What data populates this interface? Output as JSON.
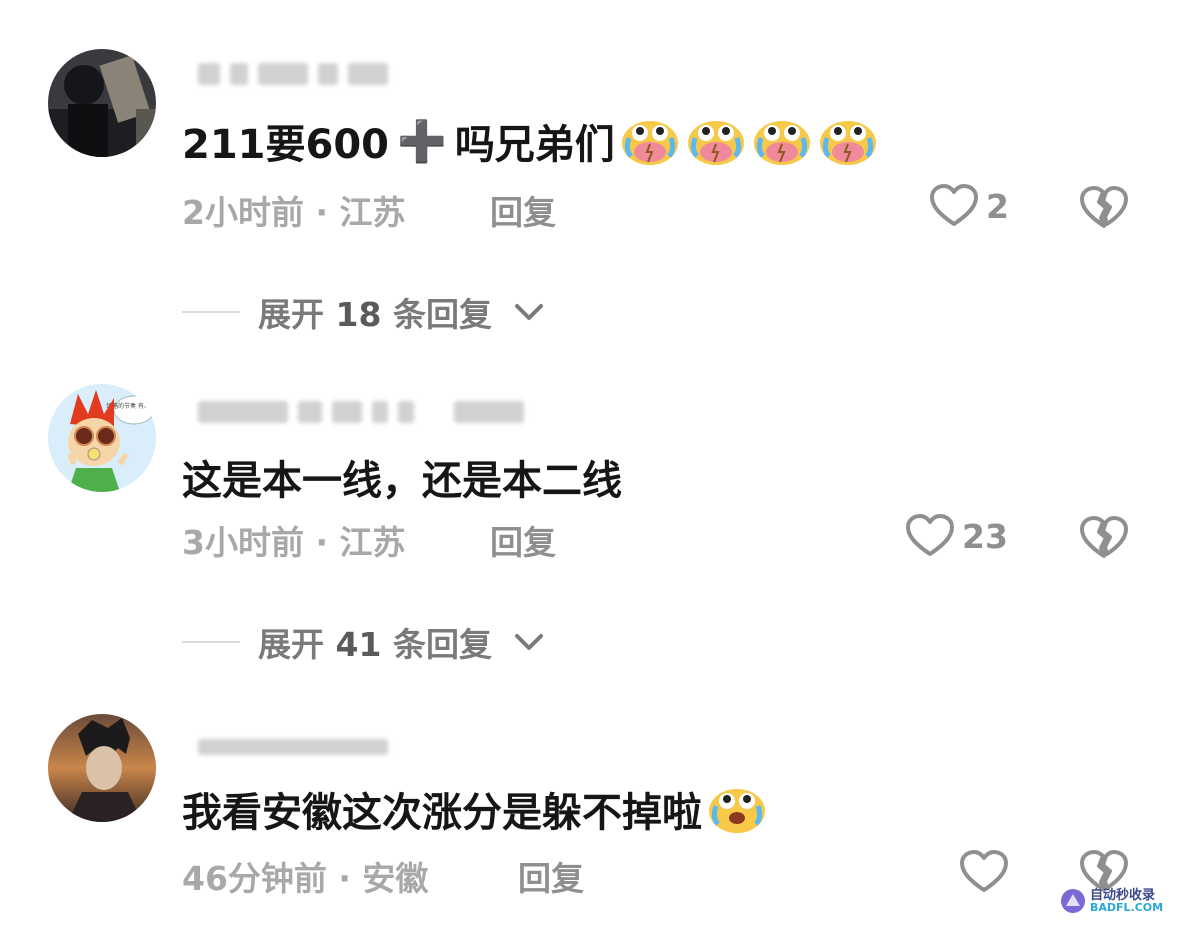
{
  "comments": [
    {
      "text": "211要600",
      "text_tail": "吗兄弟们",
      "plus_glyph": "➕",
      "emoji_count": 4,
      "time": "2小时前",
      "location": "江苏",
      "meta": "2小时前 · 江苏",
      "reply_label": "回复",
      "likes": "2",
      "expand_label": "展开",
      "expand_count": "18",
      "expand_suffix": "条回复"
    },
    {
      "text": "这是本一线，还是本二线",
      "meta": "3小时前 · 江苏",
      "reply_label": "回复",
      "likes": "23",
      "expand_label": "展开",
      "expand_count": "41",
      "expand_suffix": "条回复",
      "avatar_bubble": "领略的节奏 有木有？"
    },
    {
      "text": "我看安徽这次涨分是躲不掉啦",
      "meta": "46分钟前 · 安徽",
      "reply_label": "回复",
      "likes": ""
    }
  ],
  "watermark": {
    "cn": "自动秒收录",
    "en": "BADFL.COM"
  },
  "icons": {
    "like": "heart-outline-icon",
    "dislike": "broken-heart-icon",
    "expand": "chevron-down-icon",
    "emoji": "crying-face-emoji-icon"
  },
  "colors": {
    "text": "#161616",
    "meta": "#a8a8a8",
    "icon": "#8f8f8f"
  }
}
